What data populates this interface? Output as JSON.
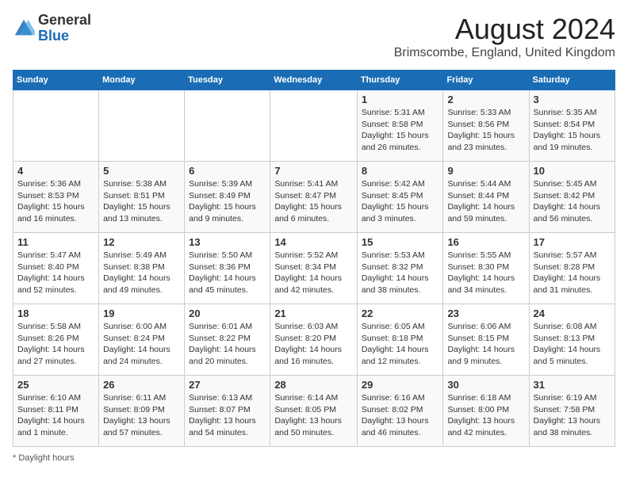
{
  "header": {
    "logo_general": "General",
    "logo_blue": "Blue",
    "main_title": "August 2024",
    "subtitle": "Brimscombe, England, United Kingdom"
  },
  "columns": [
    "Sunday",
    "Monday",
    "Tuesday",
    "Wednesday",
    "Thursday",
    "Friday",
    "Saturday"
  ],
  "footer": "Daylight hours",
  "weeks": [
    {
      "cells": [
        {
          "date": "",
          "info": ""
        },
        {
          "date": "",
          "info": ""
        },
        {
          "date": "",
          "info": ""
        },
        {
          "date": "",
          "info": ""
        },
        {
          "date": "1",
          "info": "Sunrise: 5:31 AM\nSunset: 8:58 PM\nDaylight: 15 hours\nand 26 minutes."
        },
        {
          "date": "2",
          "info": "Sunrise: 5:33 AM\nSunset: 8:56 PM\nDaylight: 15 hours\nand 23 minutes."
        },
        {
          "date": "3",
          "info": "Sunrise: 5:35 AM\nSunset: 8:54 PM\nDaylight: 15 hours\nand 19 minutes."
        }
      ]
    },
    {
      "cells": [
        {
          "date": "4",
          "info": "Sunrise: 5:36 AM\nSunset: 8:53 PM\nDaylight: 15 hours\nand 16 minutes."
        },
        {
          "date": "5",
          "info": "Sunrise: 5:38 AM\nSunset: 8:51 PM\nDaylight: 15 hours\nand 13 minutes."
        },
        {
          "date": "6",
          "info": "Sunrise: 5:39 AM\nSunset: 8:49 PM\nDaylight: 15 hours\nand 9 minutes."
        },
        {
          "date": "7",
          "info": "Sunrise: 5:41 AM\nSunset: 8:47 PM\nDaylight: 15 hours\nand 6 minutes."
        },
        {
          "date": "8",
          "info": "Sunrise: 5:42 AM\nSunset: 8:45 PM\nDaylight: 15 hours\nand 3 minutes."
        },
        {
          "date": "9",
          "info": "Sunrise: 5:44 AM\nSunset: 8:44 PM\nDaylight: 14 hours\nand 59 minutes."
        },
        {
          "date": "10",
          "info": "Sunrise: 5:45 AM\nSunset: 8:42 PM\nDaylight: 14 hours\nand 56 minutes."
        }
      ]
    },
    {
      "cells": [
        {
          "date": "11",
          "info": "Sunrise: 5:47 AM\nSunset: 8:40 PM\nDaylight: 14 hours\nand 52 minutes."
        },
        {
          "date": "12",
          "info": "Sunrise: 5:49 AM\nSunset: 8:38 PM\nDaylight: 14 hours\nand 49 minutes."
        },
        {
          "date": "13",
          "info": "Sunrise: 5:50 AM\nSunset: 8:36 PM\nDaylight: 14 hours\nand 45 minutes."
        },
        {
          "date": "14",
          "info": "Sunrise: 5:52 AM\nSunset: 8:34 PM\nDaylight: 14 hours\nand 42 minutes."
        },
        {
          "date": "15",
          "info": "Sunrise: 5:53 AM\nSunset: 8:32 PM\nDaylight: 14 hours\nand 38 minutes."
        },
        {
          "date": "16",
          "info": "Sunrise: 5:55 AM\nSunset: 8:30 PM\nDaylight: 14 hours\nand 34 minutes."
        },
        {
          "date": "17",
          "info": "Sunrise: 5:57 AM\nSunset: 8:28 PM\nDaylight: 14 hours\nand 31 minutes."
        }
      ]
    },
    {
      "cells": [
        {
          "date": "18",
          "info": "Sunrise: 5:58 AM\nSunset: 8:26 PM\nDaylight: 14 hours\nand 27 minutes."
        },
        {
          "date": "19",
          "info": "Sunrise: 6:00 AM\nSunset: 8:24 PM\nDaylight: 14 hours\nand 24 minutes."
        },
        {
          "date": "20",
          "info": "Sunrise: 6:01 AM\nSunset: 8:22 PM\nDaylight: 14 hours\nand 20 minutes."
        },
        {
          "date": "21",
          "info": "Sunrise: 6:03 AM\nSunset: 8:20 PM\nDaylight: 14 hours\nand 16 minutes."
        },
        {
          "date": "22",
          "info": "Sunrise: 6:05 AM\nSunset: 8:18 PM\nDaylight: 14 hours\nand 12 minutes."
        },
        {
          "date": "23",
          "info": "Sunrise: 6:06 AM\nSunset: 8:15 PM\nDaylight: 14 hours\nand 9 minutes."
        },
        {
          "date": "24",
          "info": "Sunrise: 6:08 AM\nSunset: 8:13 PM\nDaylight: 14 hours\nand 5 minutes."
        }
      ]
    },
    {
      "cells": [
        {
          "date": "25",
          "info": "Sunrise: 6:10 AM\nSunset: 8:11 PM\nDaylight: 14 hours\nand 1 minute."
        },
        {
          "date": "26",
          "info": "Sunrise: 6:11 AM\nSunset: 8:09 PM\nDaylight: 13 hours\nand 57 minutes."
        },
        {
          "date": "27",
          "info": "Sunrise: 6:13 AM\nSunset: 8:07 PM\nDaylight: 13 hours\nand 54 minutes."
        },
        {
          "date": "28",
          "info": "Sunrise: 6:14 AM\nSunset: 8:05 PM\nDaylight: 13 hours\nand 50 minutes."
        },
        {
          "date": "29",
          "info": "Sunrise: 6:16 AM\nSunset: 8:02 PM\nDaylight: 13 hours\nand 46 minutes."
        },
        {
          "date": "30",
          "info": "Sunrise: 6:18 AM\nSunset: 8:00 PM\nDaylight: 13 hours\nand 42 minutes."
        },
        {
          "date": "31",
          "info": "Sunrise: 6:19 AM\nSunset: 7:58 PM\nDaylight: 13 hours\nand 38 minutes."
        }
      ]
    }
  ]
}
